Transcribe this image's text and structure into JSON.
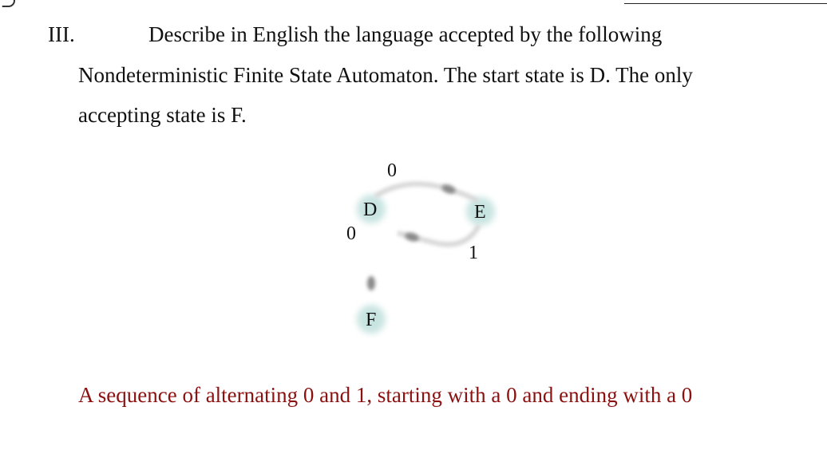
{
  "corner_mark": "⊃",
  "question": {
    "number": "III.",
    "line1": "Describe in English the language accepted by the following",
    "line2": "Nondeterministic Finite State Automaton.  The start state is D.  The only",
    "line3": "accepting state is F."
  },
  "automaton": {
    "states": [
      {
        "name": "D"
      },
      {
        "name": "E"
      },
      {
        "name": "F"
      }
    ],
    "transitions": [
      {
        "from": "D",
        "to": "E",
        "symbol": "0"
      },
      {
        "from": "E",
        "to": "D",
        "symbol": "1"
      },
      {
        "from": "D",
        "to": "F",
        "symbol": "0"
      }
    ],
    "start_state": "D",
    "accepting_state": "F"
  },
  "answer": "A sequence of alternating 0 and 1, starting with a 0 and ending with a 0",
  "colors": {
    "answer_text": "#8b1010",
    "state_glow": "#bfe0dc",
    "arrow": "#d6d6d6",
    "arrowhead": "#8a8a8a"
  }
}
